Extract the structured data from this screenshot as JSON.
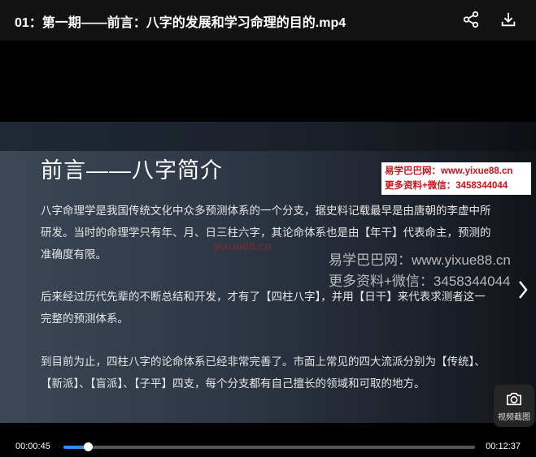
{
  "header": {
    "title": "01：第一期——前言：八字的发展和学习命理的目的.mp4"
  },
  "slide": {
    "title": "前言——八字简介",
    "paragraphs": [
      "八字命理学是我国传统文化中众多预测体系的一个分支，据史料记载最早是由唐朝的李虚中所研发。当时的命理学只有年、月、日三柱六字，其论命体系也是由【年干】代表命主，预测的准确度有限。",
      "后来经过历代先辈的不断总结和开发，才有了【四柱八字】，并用【日干】来代表求测者这一完整的预测体系。",
      "到目前为止，四柱八字的论命体系已经非常完善了。市面上常见的四大流派分别为【传统】、【新派】、【盲派】、【子平】四支，每个分支都有自己擅长的领域和可取的地方。"
    ]
  },
  "watermarks": {
    "box_line1": "易学巴巴网：www.yixue88.cn",
    "box_line2": "更多资料+微信：3458344044",
    "big_line1": "易学巴巴网：www.yixue88.cn",
    "big_line2": "更多资料+微信：3458344044",
    "faint": "yixue88.cn"
  },
  "snapshot": {
    "label": "视频截图"
  },
  "controls": {
    "current_time": "00:00:45",
    "total_time": "00:12:37",
    "progress": 0.059
  },
  "icons": {
    "share": "share-icon",
    "download": "download-icon",
    "next": "chevron-right-icon",
    "camera": "camera-icon"
  },
  "colors": {
    "accent": "#2f8cff",
    "watermark_red": "#d0101a"
  }
}
